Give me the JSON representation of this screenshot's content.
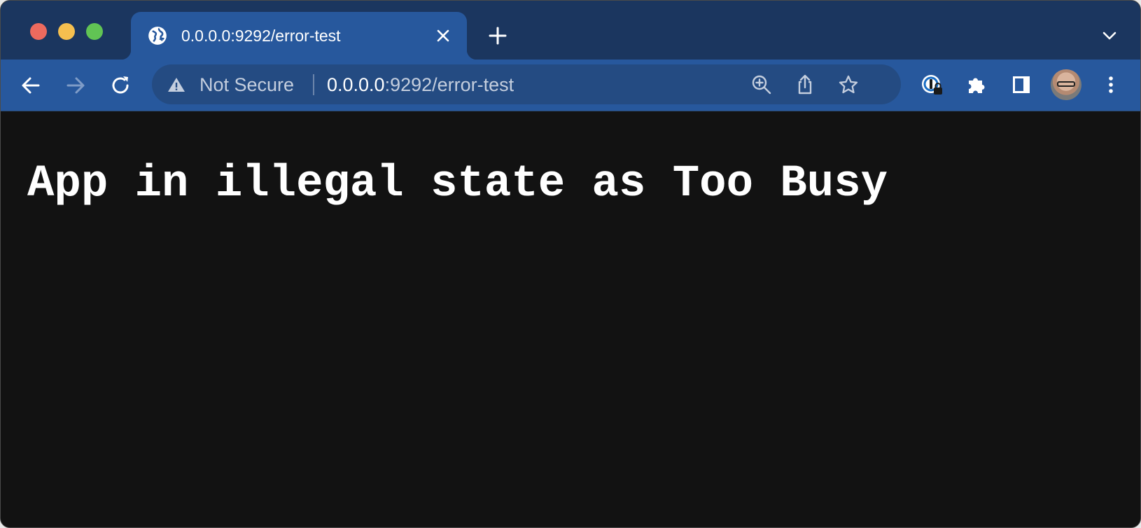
{
  "tab": {
    "title": "0.0.0.0:9292/error-test"
  },
  "omnibox": {
    "security_label": "Not Secure",
    "url_host": "0.0.0.0",
    "url_rest": ":9292/error-test"
  },
  "page": {
    "message": "App in illegal state as Too Busy"
  },
  "colors": {
    "tabstrip_bg": "#1b365f",
    "toolbar_bg": "#27589d",
    "omnibox_bg": "#244b82",
    "page_bg": "#121212",
    "page_text": "#ffffff"
  },
  "icons": {
    "window_controls": [
      "close-dot",
      "minimize-dot",
      "zoom-dot"
    ],
    "tab": [
      "globe-icon",
      "close-icon"
    ],
    "tabstrip": [
      "plus-icon",
      "chevron-down-icon"
    ],
    "navigation": [
      "back-arrow-icon",
      "forward-arrow-icon",
      "reload-icon"
    ],
    "omnibox": [
      "warning-icon",
      "zoom-icon",
      "share-icon",
      "star-icon"
    ],
    "toolbar": [
      "password-manager-icon",
      "puzzle-icon",
      "side-panel-icon",
      "avatar",
      "more-vert-icon"
    ]
  }
}
